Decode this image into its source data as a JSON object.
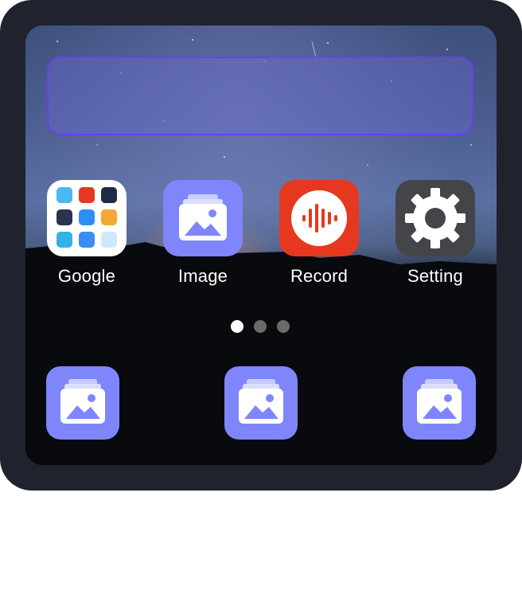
{
  "apps": [
    {
      "label": "Google",
      "icon": "google-folder-icon"
    },
    {
      "label": "Image",
      "icon": "image-gallery-icon"
    },
    {
      "label": "Record",
      "icon": "record-waveform-icon"
    },
    {
      "label": "Setting",
      "icon": "gear-icon"
    }
  ],
  "dock": [
    {
      "icon": "image-gallery-icon"
    },
    {
      "icon": "image-gallery-icon"
    },
    {
      "icon": "image-gallery-icon"
    }
  ],
  "page_indicator": {
    "pages": 3,
    "current": 1
  },
  "colors": {
    "device_bezel": "#20232d",
    "widget_border": "#6a3ff2",
    "image_tile": "#7f86fb",
    "record_tile": "#e5391f",
    "setting_tile": "#444549",
    "dot_active": "#ffffff",
    "dot_inactive": "#6b6b6b"
  }
}
